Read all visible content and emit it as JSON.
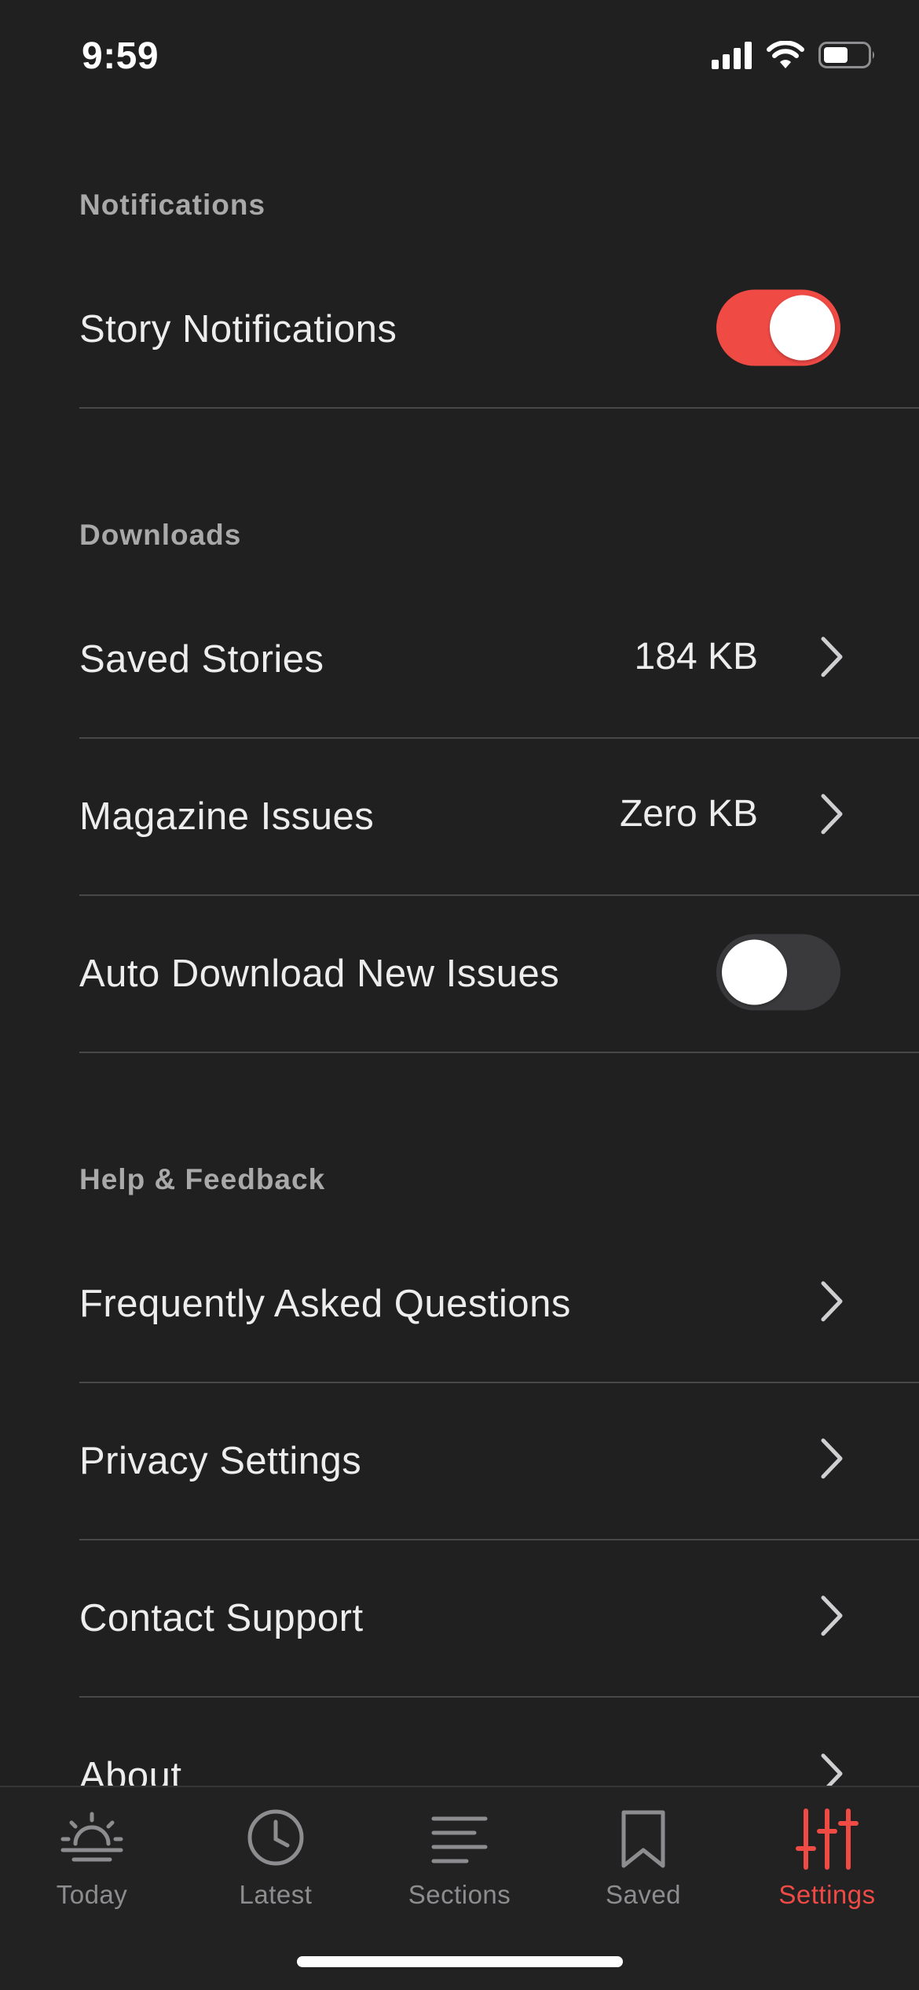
{
  "status_bar": {
    "time": "9:59"
  },
  "sections": {
    "notifications": {
      "header": "Notifications",
      "story_notifications": {
        "label": "Story Notifications",
        "enabled": true
      }
    },
    "downloads": {
      "header": "Downloads",
      "saved_stories": {
        "label": "Saved Stories",
        "value": "184 KB"
      },
      "magazine_issues": {
        "label": "Magazine Issues",
        "value": "Zero KB"
      },
      "auto_download": {
        "label": "Auto Download New Issues",
        "enabled": false
      }
    },
    "help": {
      "header": "Help & Feedback",
      "faq": {
        "label": "Frequently Asked Questions"
      },
      "privacy": {
        "label": "Privacy Settings"
      },
      "contact": {
        "label": "Contact Support"
      },
      "about": {
        "label": "About"
      }
    }
  },
  "tab_bar": {
    "tabs": [
      {
        "label": "Today",
        "icon": "sunrise-icon",
        "active": false
      },
      {
        "label": "Latest",
        "icon": "clock-icon",
        "active": false
      },
      {
        "label": "Sections",
        "icon": "lines-icon",
        "active": false
      },
      {
        "label": "Saved",
        "icon": "bookmark-icon",
        "active": false
      },
      {
        "label": "Settings",
        "icon": "sliders-icon",
        "active": true
      }
    ]
  },
  "colors": {
    "background": "#202021",
    "accent": "#f04a45",
    "section_header": "#a9a9aa",
    "inactive_tab": "#8d8d90"
  }
}
